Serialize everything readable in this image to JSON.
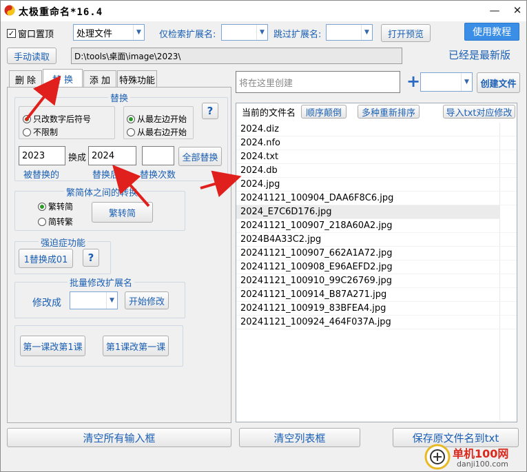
{
  "titlebar": {
    "title": "太极重命名*16.4"
  },
  "toolbar": {
    "window_top_label": "窗口置顶",
    "process_files_value": "处理文件",
    "only_search_ext_label": "仅检索扩展名:",
    "skip_ext_label": "跳过扩展名:",
    "preview_button": "打开预览",
    "tutorial_button": "使用教程",
    "manual_read_button": "手动读取",
    "path_value": "D:\\tools\\桌面\\image\\2023\\",
    "update_status": "已经是最新版"
  },
  "tabs": [
    {
      "label": "删 除"
    },
    {
      "label": "替 换"
    },
    {
      "label": "添 加"
    },
    {
      "label": "特殊功能"
    }
  ],
  "replace_panel": {
    "group_title": "替换",
    "radio_digits_only": "只改数字后符号",
    "radio_unlimited": "不限制",
    "radio_from_left": "从最左边开始",
    "radio_from_right": "从最右边开始",
    "help_button": "?",
    "find_value": "2023",
    "replace_with_label": "换成",
    "replace_value": "2024",
    "count_value": "",
    "replace_all_button": "全部替换",
    "find_caption": "被替换的",
    "replace_caption": "替换后的",
    "count_caption": "替换次数"
  },
  "convert_panel": {
    "group_title": "繁简体之间的转换",
    "radio_trad_to_simp": "繁转简",
    "radio_simp_to_trad": "简转繁",
    "convert_button": "繁转简"
  },
  "ocd_panel": {
    "group_title": "强迫症功能",
    "replace_1_01_button": "1替换成01",
    "help_button": "?"
  },
  "batch_ext_panel": {
    "group_title": "批量修改扩展名",
    "modify_to_label": "修改成",
    "ext_value": "",
    "start_button": "开始修改"
  },
  "lesson_panel": {
    "button_a": "第一课改第1课",
    "button_b": "第1课改第一课"
  },
  "right_top": {
    "create_placeholder": "将在这里创建",
    "plus": "+",
    "ext_combo_value": "",
    "create_file_button": "创建文件"
  },
  "list": {
    "header_current": "当前的文件名",
    "header_reverse": "顺序颠倒",
    "header_resort": "多种重新排序",
    "header_import": "导入txt对应修改",
    "rows": [
      "2024.diz",
      "2024.nfo",
      "2024.txt",
      "2024.db",
      "2024.jpg",
      "20241121_100904_DAA6F8C6.jpg",
      "2024_E7C6D176.jpg",
      "20241121_100907_218A60A2.jpg",
      "2024B4A33C2.jpg",
      "20241121_100907_662A1A72.jpg",
      "20241121_100908_E96AEFD2.jpg",
      "20241121_100910_99C26769.jpg",
      "20241121_100914_B87A271.jpg",
      "20241121_100919_83BFEA4.jpg",
      "20241121_100924_464F037A.jpg"
    ]
  },
  "bottom": {
    "clear_inputs_button": "清空所有输入框",
    "clear_list_button": "清空列表框",
    "save_names_button": "保存原文件名到txt"
  },
  "watermark": {
    "text_main": "单机100网",
    "text_sub": "danji100.com"
  },
  "colors": {
    "accent": "#1a5fb4",
    "primary_button": "#3a8ee6",
    "arrow": "#e0201c"
  },
  "icons": {
    "app": "taiji-icon",
    "minimize": "minimize-icon",
    "close": "close-icon",
    "checkbox": "checkbox-checked-icon"
  }
}
